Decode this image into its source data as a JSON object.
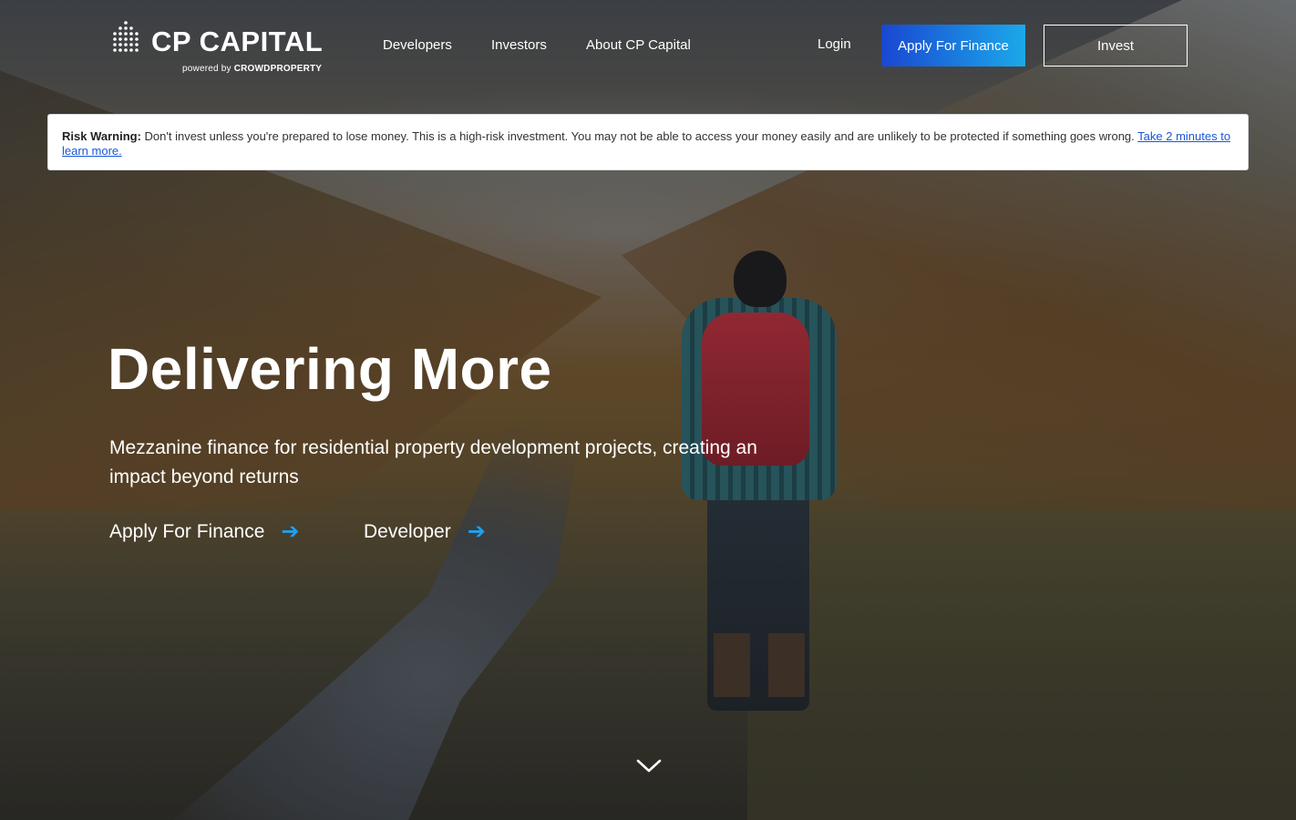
{
  "brand": {
    "name": "CP CAPITAL",
    "powered_prefix": "powered by",
    "powered_name": "CROWDPROPERTY"
  },
  "nav": {
    "links": [
      "Developers",
      "Investors",
      "About CP Capital"
    ],
    "login": "Login",
    "apply_button": "Apply For Finance",
    "invest_button": "Invest"
  },
  "risk_warning": {
    "label": "Risk Warning:",
    "text": " Don't invest unless you're prepared to lose money. This is a high-risk investment. You may not be able to access your money easily and are unlikely to be protected if something goes wrong. ",
    "link": "Take 2 minutes to learn more."
  },
  "hero": {
    "headline": "Delivering More",
    "subheadline": "Mezzanine finance for residential property development projects, creating an impact beyond returns",
    "cta_primary": "Apply For Finance",
    "cta_secondary": "Developer",
    "arrow_glyph": "➔"
  },
  "colors": {
    "accent_blue": "#1da1f2",
    "apply_gradient_start": "#1a47d1",
    "apply_gradient_end": "#1ba9ea"
  }
}
